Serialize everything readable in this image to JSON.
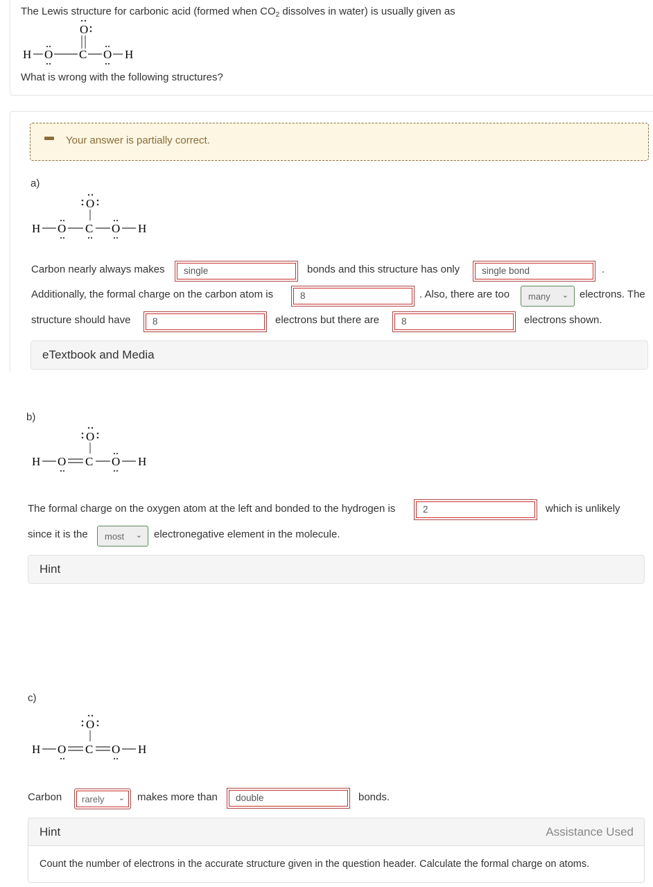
{
  "question": {
    "intro_pre": "The Lewis structure for carbonic acid (formed when CO",
    "intro_sub": "2",
    "intro_post": " dissolves in water) is usually given as",
    "prompt": "What is wrong with the following structures?",
    "structure": {
      "atoms": [
        "H",
        "O",
        "C",
        "O",
        "H"
      ],
      "top_atom": "O",
      "top_bond": "double"
    }
  },
  "feedback": {
    "icon": "minus-icon",
    "message": "Your answer is partially correct.",
    "color": "#8a6d3b",
    "background": "#fcf6e3"
  },
  "parts": {
    "a": {
      "label": "a)",
      "structure": {
        "atoms": [
          "H",
          "O",
          "C",
          "O",
          "H"
        ],
        "top_atom": "O",
        "top_bond": "single",
        "left_bond": "single",
        "right_bond": "single"
      },
      "text1": "Carbon nearly always makes",
      "input1": "single",
      "text2": "bonds and this structure has only",
      "input2": "single bond",
      "text3": ".",
      "text4": "Additionally, the formal charge on the carbon atom is",
      "input3": "8",
      "text5": ". Also, there are too",
      "select1": "many",
      "text6": "electrons. The",
      "text7": "structure should have",
      "input4": "8",
      "text8": "electrons but there are",
      "input5": "8",
      "text9": "electrons shown.",
      "resource": "eTextbook and Media"
    },
    "b": {
      "label": "b)",
      "structure": {
        "atoms": [
          "H",
          "O",
          "C",
          "O",
          "H"
        ],
        "top_atom": "O",
        "top_bond": "single",
        "left_bond": "double",
        "right_bond": "single"
      },
      "text1": "The formal charge on the oxygen atom at the left and bonded to the hydrogen is",
      "input1": "2",
      "text2": "which is unlikely",
      "text3": "since it is the",
      "select1": "most",
      "text4": "electronegative element in the molecule.",
      "hint": "Hint"
    },
    "c": {
      "label": "c)",
      "structure": {
        "atoms": [
          "H",
          "O",
          "C",
          "O",
          "H"
        ],
        "top_atom": "O",
        "top_bond": "single",
        "left_bond": "double",
        "right_bond": "double"
      },
      "text1": "Carbon",
      "select1": "rarely",
      "text2": "makes more than",
      "input1": "double",
      "text3": "bonds.",
      "hint_title": "Hint",
      "hint_status": "Assistance Used",
      "hint_body": "Count the number of electrons in the accurate structure given in the question header. Calculate the formal charge on atoms."
    }
  },
  "colors": {
    "incorrect_border": "#a94442",
    "correct_border": "#5c8a5c"
  }
}
